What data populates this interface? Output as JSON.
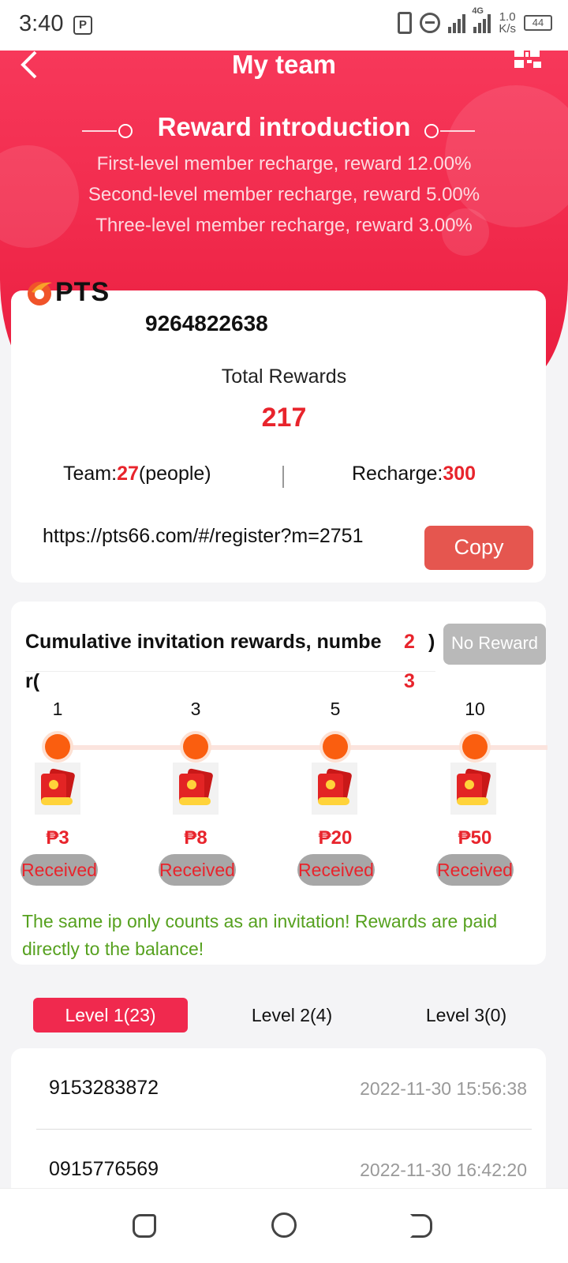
{
  "status_bar": {
    "time": "3:40",
    "app_badge": "P",
    "network_type": "4G",
    "net_speed_value": "1.0",
    "net_speed_unit": "K/s",
    "battery": "44"
  },
  "header": {
    "title": "My team",
    "back_icon": "chevron-left-icon",
    "qr_icon": "qr-code-icon"
  },
  "reward_intro": {
    "heading": "Reward introduction",
    "rules": [
      "First-level member recharge, reward 12.00%",
      "Second-level member recharge, reward 5.00%",
      "Three-level member recharge, reward 3.00%"
    ]
  },
  "brand": {
    "logo_text": "PTS"
  },
  "summary": {
    "user_id": "9264822638",
    "total_rewards_label": "Total Rewards",
    "total_rewards_value": "217",
    "team_label": "Team:",
    "team_value": "27",
    "team_suffix": "(people)",
    "recharge_label": "Recharge:",
    "recharge_value": "300",
    "invite_link": "https://pts66.com/#/register?m=2751",
    "copy_label": "Copy"
  },
  "invitation": {
    "title_line1": "Cumulative invitation rewards, numbe",
    "title_line2": "r(",
    "count_line1": "2",
    "count_line2": "3",
    "close_paren": ")",
    "no_reward_label": "No Reward",
    "steps": [
      {
        "count": "1",
        "amount": "₱3",
        "status": "Received"
      },
      {
        "count": "3",
        "amount": "₱8",
        "status": "Received"
      },
      {
        "count": "5",
        "amount": "₱20",
        "status": "Received"
      },
      {
        "count": "10",
        "amount": "₱50",
        "status": "Received"
      }
    ],
    "note": "The same ip only counts as an invitation! Rewards are paid directly to the balance!"
  },
  "tabs": [
    {
      "label": "Level 1(23)",
      "active": true
    },
    {
      "label": "Level 2(4)",
      "active": false
    },
    {
      "label": "Level 3(0)",
      "active": false
    }
  ],
  "members": [
    {
      "phone": "9153283872",
      "time": "2022-11-30 15:56:38"
    },
    {
      "phone": "0915776569",
      "time": "2022-11-30 16:42:20"
    }
  ],
  "colors": {
    "brand_red": "#f0294e",
    "accent_red": "#e8242c",
    "copy_button": "#e5564f",
    "step_orange": "#fa5e0f",
    "note_green": "#56a11f"
  }
}
